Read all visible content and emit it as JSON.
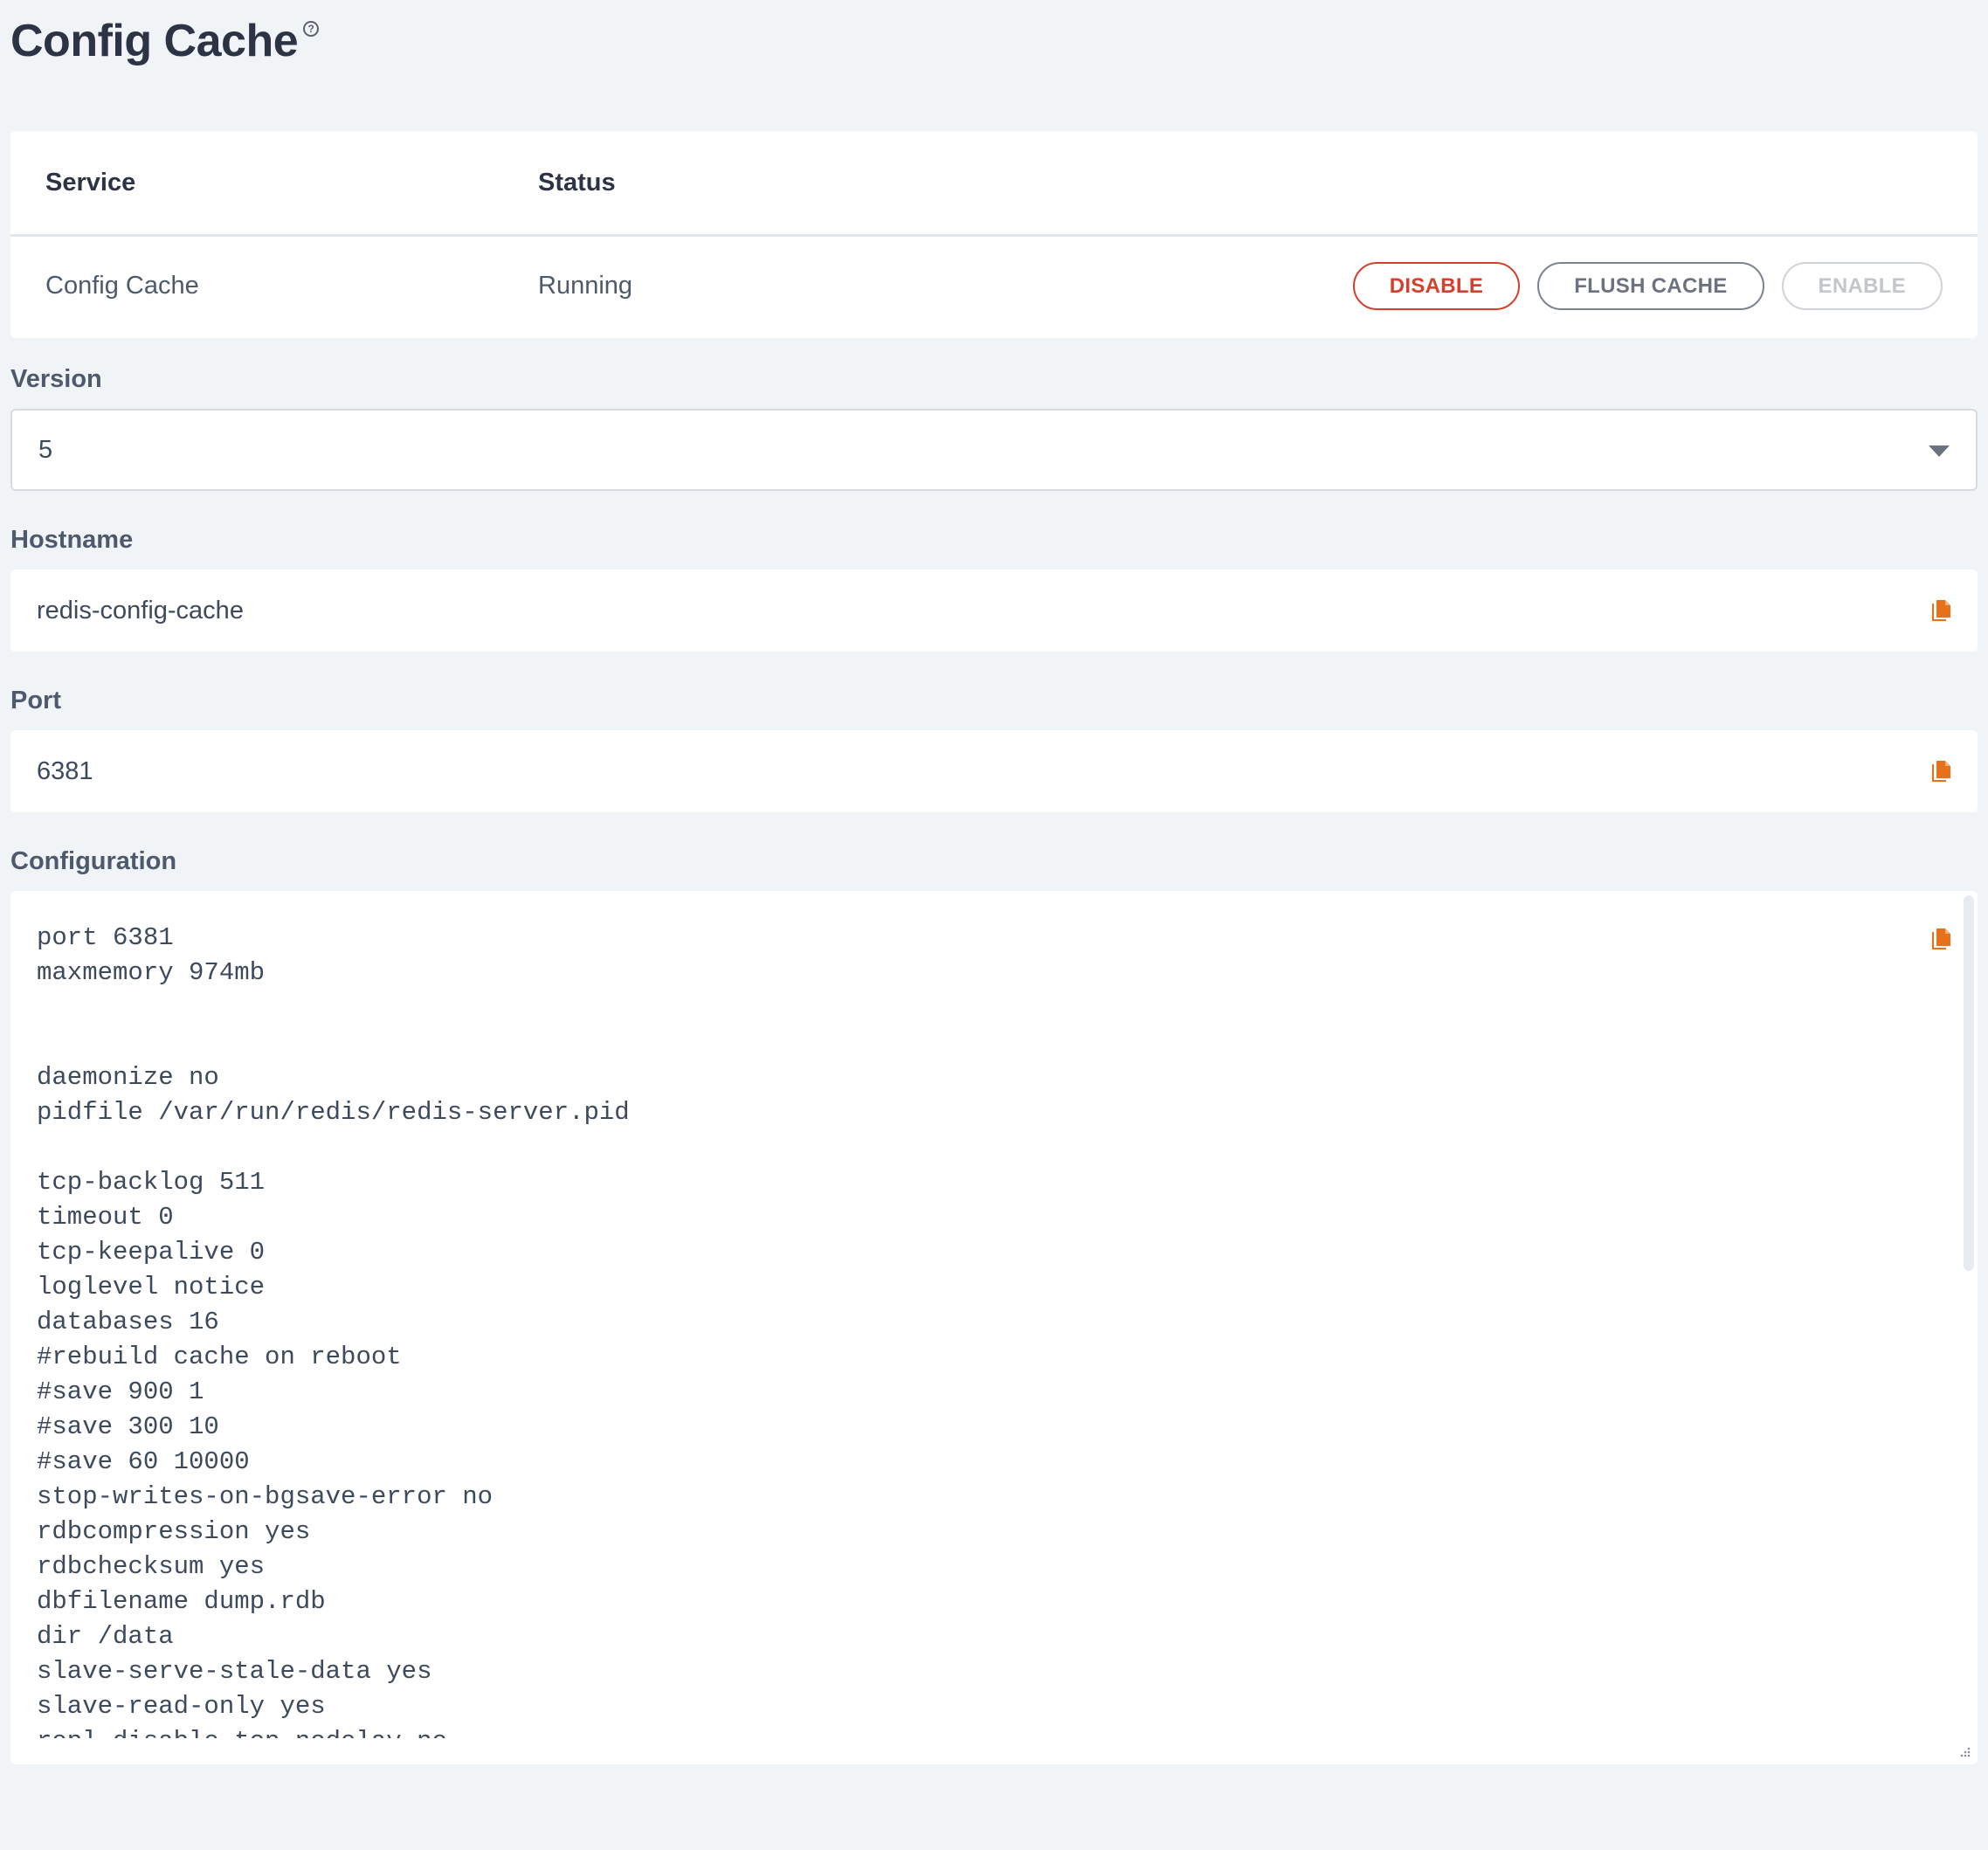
{
  "header": {
    "title": "Config Cache",
    "help_glyph": "?"
  },
  "service_table": {
    "columns": [
      "Service",
      "Status"
    ],
    "row": {
      "service": "Config Cache",
      "status": "Running"
    },
    "actions": {
      "disable_label": "DISABLE",
      "flush_label": "FLUSH CACHE",
      "enable_label": "ENABLE"
    }
  },
  "version": {
    "label": "Version",
    "selected": "5"
  },
  "hostname": {
    "label": "Hostname",
    "value": "redis-config-cache"
  },
  "port": {
    "label": "Port",
    "value": "6381"
  },
  "configuration": {
    "label": "Configuration",
    "text": "port 6381\nmaxmemory 974mb\n\n\ndaemonize no\npidfile /var/run/redis/redis-server.pid\n\ntcp-backlog 511\ntimeout 0\ntcp-keepalive 0\nloglevel notice\ndatabases 16\n#rebuild cache on reboot\n#save 900 1\n#save 300 10\n#save 60 10000\nstop-writes-on-bgsave-error no\nrdbcompression yes\nrdbchecksum yes\ndbfilename dump.rdb\ndir /data\nslave-serve-stale-data yes\nslave-read-only yes\nrepl-disable-tcp-nodelay no"
  },
  "icons": {
    "copy": "copy-icon",
    "dropdown": "chevron-down-icon",
    "help": "help-icon"
  },
  "colors": {
    "accent": "#e8701a",
    "danger": "#d63f2c",
    "background": "#f1f4f7"
  }
}
